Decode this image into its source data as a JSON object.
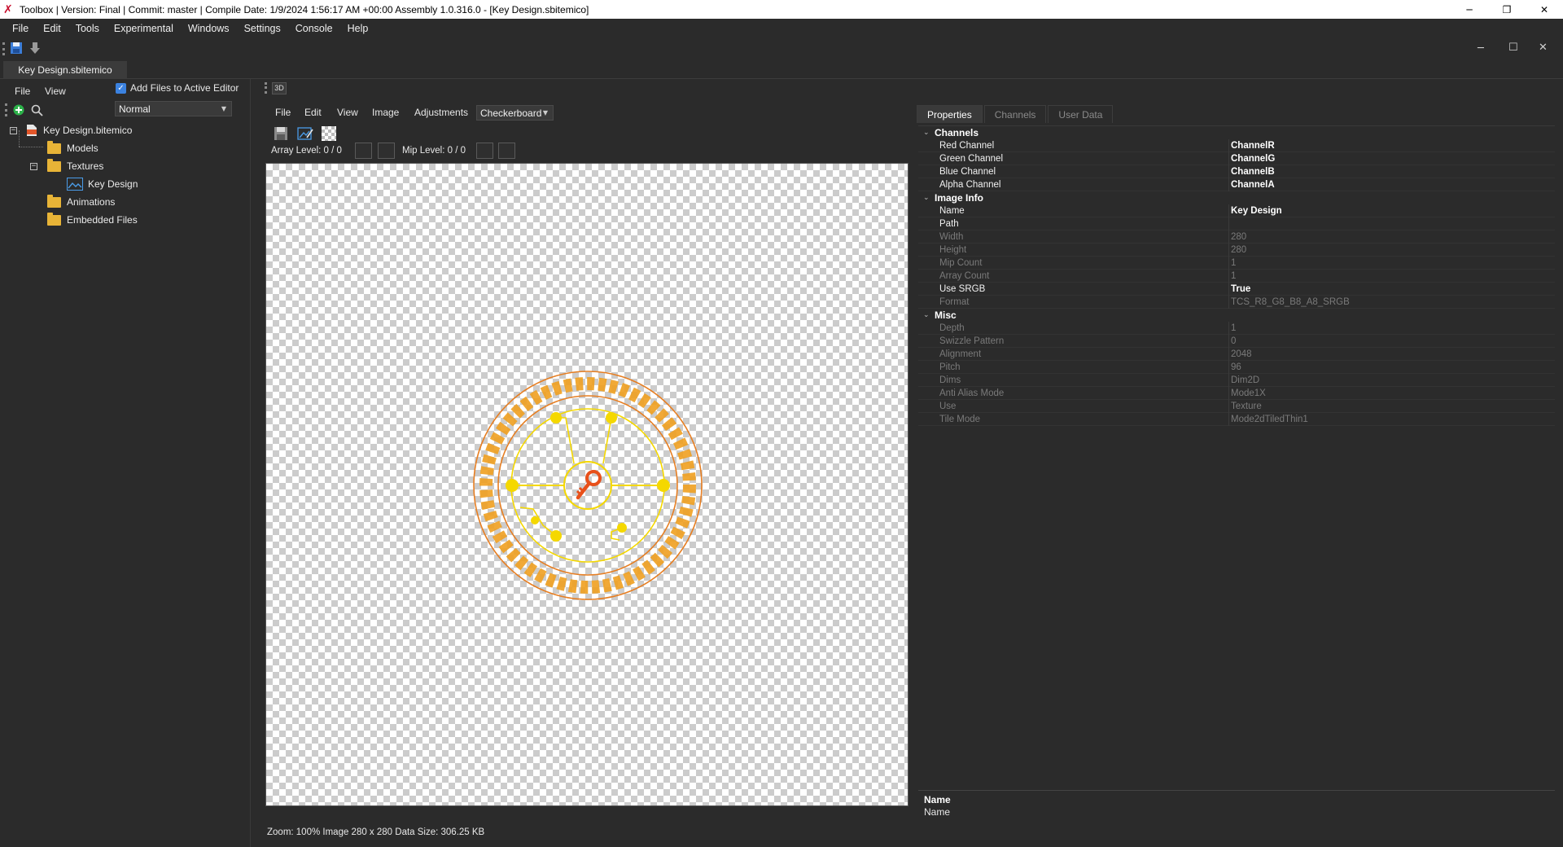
{
  "window": {
    "title": "Toolbox | Version: Final | Commit: master | Compile Date: 1/9/2024 1:56:17 AM +00:00 Assembly 1.0.316.0 - [Key Design.sbitemico]",
    "minimize": "─",
    "restore": "❐",
    "close": "✕"
  },
  "menu": [
    "File",
    "Edit",
    "Tools",
    "Experimental",
    "Windows",
    "Settings",
    "Console",
    "Help"
  ],
  "inner_window": {
    "minimize": "─",
    "maximize": "☐",
    "close": "✕"
  },
  "doc_tab": "Key Design.sbitemico",
  "left_panel": {
    "menu": [
      "File",
      "View"
    ],
    "add_files_label": "Add Files to Active Editor",
    "add_files_checked": true,
    "mode_combo": "Normal",
    "tree": {
      "root": "Key Design.bitemico",
      "models": "Models",
      "textures": "Textures",
      "texture_item": "Key Design",
      "animations": "Animations",
      "embedded": "Embedded Files"
    },
    "expander_minus": "−"
  },
  "center": {
    "toolbar_3d": "3D",
    "menu": [
      "File",
      "Edit",
      "View",
      "Image",
      "Adjustments"
    ],
    "background_combo": "Checkerboard",
    "array_level": "Array Level: 0 / 0",
    "mip_level": "Mip Level: 0 / 0",
    "status": "Zoom: 100% Image 280 x 280 Data Size: 306.25 KB"
  },
  "right_panel": {
    "tabs": [
      "Properties",
      "Channels",
      "User Data"
    ],
    "categories": {
      "channels": "Channels",
      "image_info": "Image Info",
      "misc": "Misc"
    },
    "channels": [
      {
        "name": "Red Channel",
        "value": "ChannelR"
      },
      {
        "name": "Green Channel",
        "value": "ChannelG"
      },
      {
        "name": "Blue Channel",
        "value": "ChannelB"
      },
      {
        "name": "Alpha Channel",
        "value": "ChannelA"
      }
    ],
    "image_info": [
      {
        "name": "Name",
        "value": "Key Design",
        "enabled": true
      },
      {
        "name": "Path",
        "value": "",
        "enabled": true
      },
      {
        "name": "Width",
        "value": "280",
        "enabled": false
      },
      {
        "name": "Height",
        "value": "280",
        "enabled": false
      },
      {
        "name": "Mip Count",
        "value": "1",
        "enabled": false
      },
      {
        "name": "Array Count",
        "value": "1",
        "enabled": false
      },
      {
        "name": "Use SRGB",
        "value": "True",
        "enabled": true
      },
      {
        "name": "Format",
        "value": "TCS_R8_G8_B8_A8_SRGB",
        "enabled": false
      }
    ],
    "misc": [
      {
        "name": "Depth",
        "value": "1"
      },
      {
        "name": "Swizzle Pattern",
        "value": "0"
      },
      {
        "name": "Alignment",
        "value": "2048"
      },
      {
        "name": "Pitch",
        "value": "96"
      },
      {
        "name": "Dims",
        "value": "Dim2D"
      },
      {
        "name": "Anti Alias Mode",
        "value": "Mode1X"
      },
      {
        "name": "Use",
        "value": "Texture"
      },
      {
        "name": "Tile Mode",
        "value": "Mode2dTiledThin1"
      }
    ],
    "description": {
      "title": "Name",
      "text": "Name"
    }
  },
  "colors": {
    "accent_orange": "#e67e22",
    "rune_orange": "#f0a020",
    "circuit_yellow": "#f5d800",
    "key_red": "#e8501a"
  }
}
